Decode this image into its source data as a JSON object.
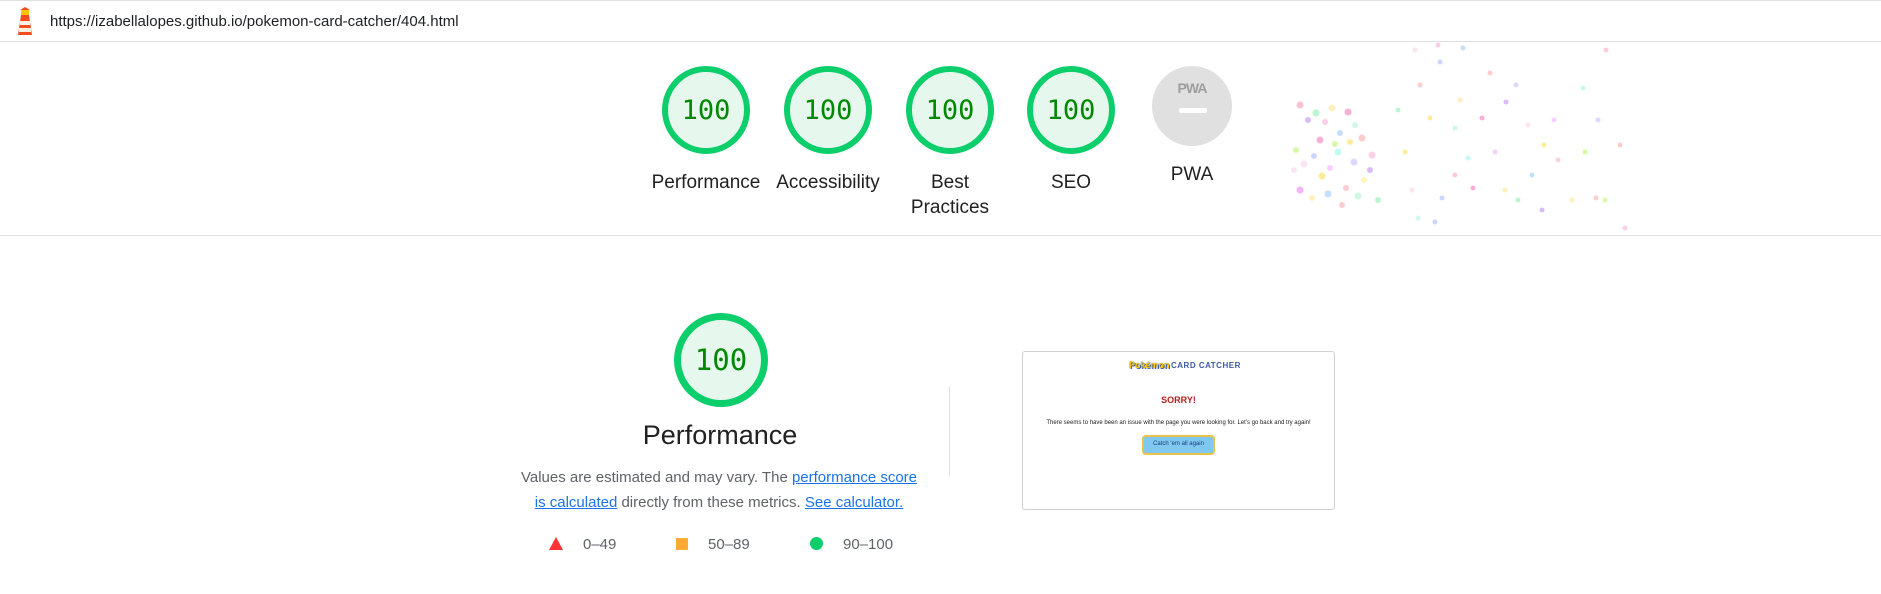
{
  "topbar": {
    "icon": "lighthouse-icon",
    "url": "https://izabellalopes.github.io/pokemon-card-catcher/404.html"
  },
  "categories": [
    {
      "score": "100",
      "label": "Performance"
    },
    {
      "score": "100",
      "label": "Accessibility"
    },
    {
      "score": "100",
      "label": "Best Practices"
    },
    {
      "score": "100",
      "label": "SEO"
    },
    {
      "badge": "PWA",
      "label": "PWA"
    }
  ],
  "performance": {
    "score": "100",
    "title": "Performance",
    "desc_prefix": "Values are estimated and may vary. The ",
    "score_link": "performance score is calculated",
    "desc_middle": " directly from these metrics. ",
    "calculator_link": "See calculator."
  },
  "legend": [
    {
      "icon": "red-triangle-icon",
      "range": "0–49"
    },
    {
      "icon": "orange-square-icon",
      "range": "50–89"
    },
    {
      "icon": "green-circle-icon",
      "range": "90–100"
    }
  ],
  "screenshot": {
    "logo_text": "Pokémon",
    "brand_text": "CARD CATCHER",
    "heading": "SORRY!",
    "message": "There seems to have been an issue with the page you were looking for. Let's go back and try again!",
    "button": "Catch 'em all again"
  },
  "colors": {
    "pass": "#0cce6b",
    "pass_text": "#008800",
    "average": "#ffaa33",
    "fail": "#ff3333",
    "link": "#1a73e8"
  }
}
